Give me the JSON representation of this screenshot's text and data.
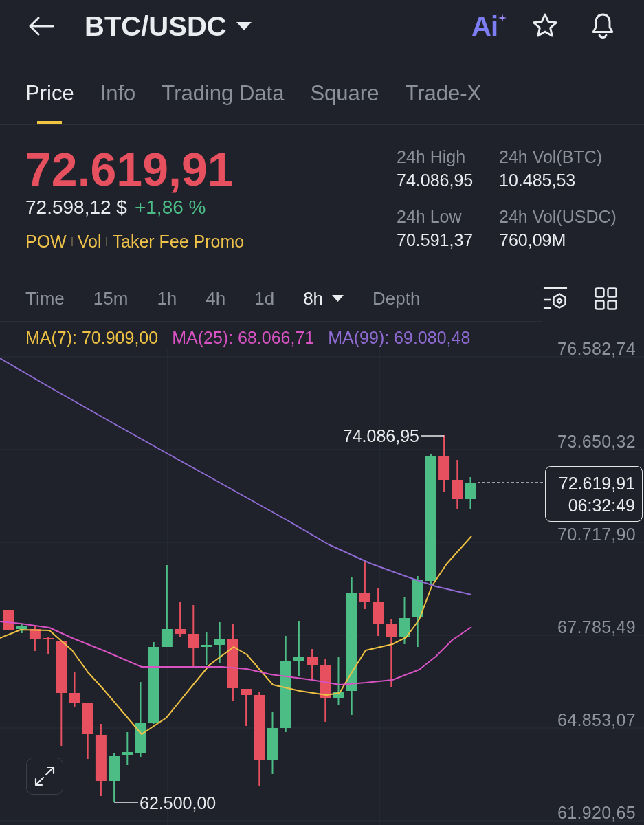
{
  "header": {
    "title": "BTC/USDC",
    "ai_label": "Ai"
  },
  "tabs": [
    {
      "label": "Price",
      "selected": true
    },
    {
      "label": "Info",
      "selected": false
    },
    {
      "label": "Trading Data",
      "selected": false
    },
    {
      "label": "Square",
      "selected": false
    },
    {
      "label": "Trade-X",
      "selected": false
    }
  ],
  "ticker": {
    "last_price": {
      "value": "72.619,91",
      "falling": true
    },
    "fiat_price": "72.598,12 $",
    "change": {
      "value": "+1,86 %",
      "falling": false
    },
    "tags": [
      "POW",
      "Vol",
      "Taker Fee Promo"
    ],
    "stats": [
      {
        "label": "24h High",
        "value": "74.086,95"
      },
      {
        "label": "24h Vol(BTC)",
        "value": "10.485,53"
      },
      {
        "label": "24h Low",
        "value": "70.591,37"
      },
      {
        "label": "24h Vol(USDC)",
        "value": "760,09M"
      }
    ]
  },
  "intervals": [
    {
      "label": "Time",
      "kind": "option",
      "selected": false
    },
    {
      "label": "15m",
      "kind": "option",
      "selected": false
    },
    {
      "label": "1h",
      "kind": "option",
      "selected": false
    },
    {
      "label": "4h",
      "kind": "option",
      "selected": false
    },
    {
      "label": "1d",
      "kind": "option",
      "selected": false
    },
    {
      "label": "8h",
      "kind": "dropdown",
      "selected": true
    },
    {
      "label": "Depth",
      "kind": "option",
      "selected": false
    }
  ],
  "chart": {
    "indicators": [
      {
        "label": "MA(7): 70.909,00",
        "color": "#efc244"
      },
      {
        "label": "MA(25): 68.066,71",
        "color": "#d752c2"
      },
      {
        "label": "MA(99): 69.080,48",
        "color": "#8f6bd3"
      }
    ],
    "price_axis": [
      "76.582,74",
      "73.650,32",
      "70.717,90",
      "67.785,49",
      "64.853,07",
      "61.920,65"
    ],
    "high_label": "74.086,95",
    "low_label": "62.500,00",
    "last_price": "72.619,91",
    "countdown": "06:32:49"
  }
}
